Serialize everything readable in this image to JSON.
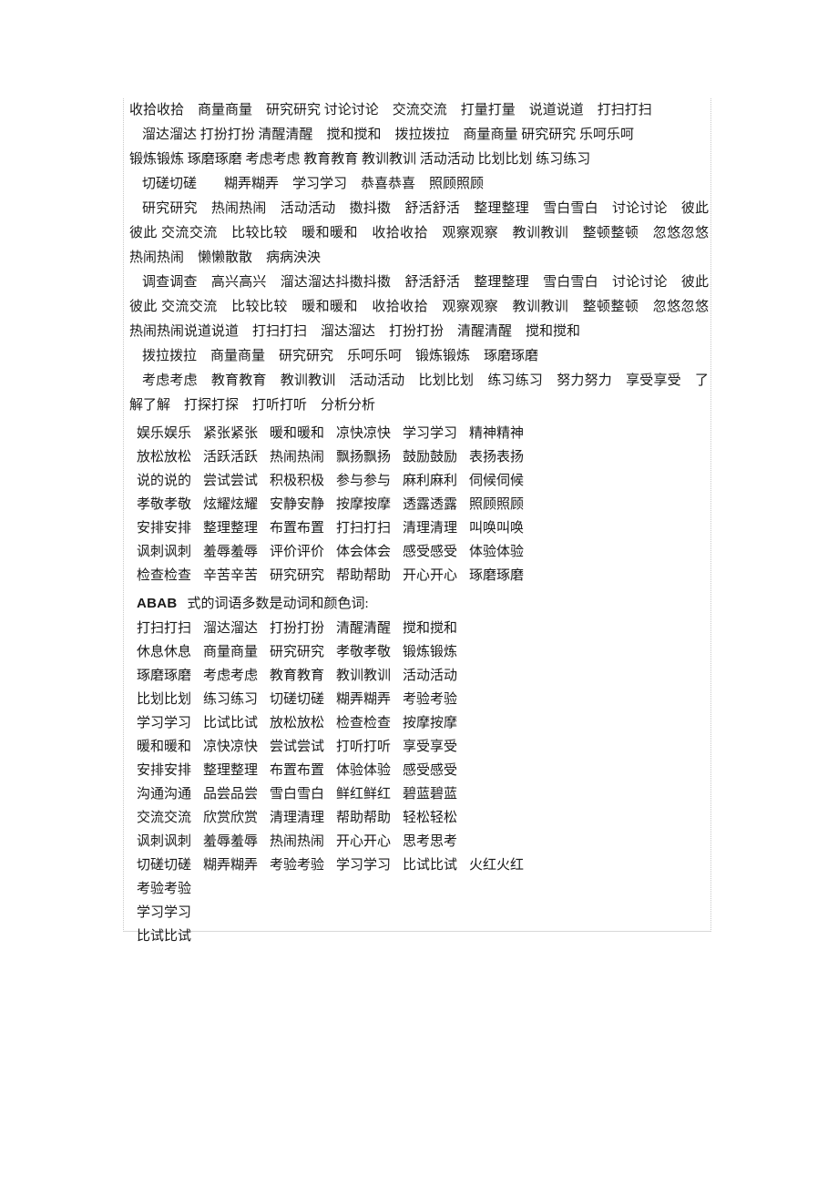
{
  "document": {
    "heading": {
      "abab_label": "ABAB",
      "rest": "式的词语多数是动词和颜色词:"
    },
    "blocks": [
      {
        "name": "block-aabb-verbs-1",
        "lines": [
          "收拾收拾　商量商量　研究研究 讨论讨论　交流交流　打量打量　说道说道　打扫打扫 溜达溜达 打扮打扮 清醒清醒 搅和搅和 拨拉拨拉 商量商量 研究研究 乐呵乐呵 锻炼锻炼 琢磨琢磨 考虑考虑 教育教育 教训教训 活动活动 比划比划 练习练习"
        ]
      }
    ],
    "paragraphs": [
      {
        "name": "para-1",
        "indent": false,
        "text": "收拾收拾　商量商量　研究研究 讨论讨论　交流交流　打量打量　说道说道　打扫打扫"
      },
      {
        "name": "para-2",
        "indent": true,
        "text": "溜达溜达 打扮打扮 清醒清醒　搅和搅和　拨拉拨拉　商量商量 研究研究 乐呵乐呵"
      },
      {
        "name": "para-3",
        "indent": false,
        "text": "锻炼锻炼 琢磨琢磨 考虑考虑 教育教育 教训教训 活动活动 比划比划 练习练习"
      },
      {
        "name": "para-4",
        "indent": true,
        "text": "切磋切磋　　糊弄糊弄　学习学习　恭喜恭喜　照顾照顾"
      },
      {
        "name": "para-5",
        "indent": true,
        "text": "研究研究　热闹热闹　活动活动　擞抖擞　舒活舒活　整理整理　雪白雪白　讨论讨论　彼此彼此 交流交流　比较比较　暖和暖和　收拾收拾　观察观察　教训教训　整顿整顿　忽悠忽悠　热闹热闹　懒懒散散　病病泱泱"
      },
      {
        "name": "para-6",
        "indent": true,
        "text": "调查调查　高兴高兴　溜达溜达抖擞抖擞　舒活舒活　整理整理　雪白雪白　讨论讨论　彼此彼此 交流交流　比较比较　暖和暖和　收拾收拾　观察观察　教训教训　整顿整顿　忽悠忽悠　热闹热闹说道说道　打扫打扫　溜达溜达　打扮打扮　清醒清醒　搅和搅和"
      },
      {
        "name": "para-7",
        "indent": true,
        "text": "拨拉拨拉　商量商量　研究研究　乐呵乐呵　锻炼锻炼　琢磨琢磨"
      },
      {
        "name": "para-8",
        "indent": true,
        "text": "考虑考虑　教育教育　教训教训　活动活动　比划比划　练习练习　努力努力　享受享受　了解了解　打探打探　打听打听　分析分析"
      }
    ],
    "grid_block_1": {
      "name": "verb-color-grid-six-column",
      "columns": 6,
      "rows": [
        [
          "娱乐娱乐",
          "紧张紧张",
          "暖和暖和",
          "凉快凉快",
          "学习学习",
          "精神精神"
        ],
        [
          "放松放松",
          "活跃活跃",
          "热闹热闹",
          "飘扬飘扬",
          "鼓励鼓励",
          "表扬表扬"
        ],
        [
          "说的说的",
          "尝试尝试",
          "积极积极",
          "参与参与",
          "麻利麻利",
          "伺候伺候"
        ],
        [
          "孝敬孝敬",
          "炫耀炫耀",
          "安静安静",
          "按摩按摩",
          "透露透露",
          "照顾照顾"
        ],
        [
          "安排安排",
          "整理整理",
          "布置布置",
          "打扫打扫",
          "清理清理",
          "叫唤叫唤"
        ],
        [
          "讽刺讽刺",
          "羞辱羞辱",
          "评价评价",
          "体会体会",
          "感受感受",
          "体验体验"
        ],
        [
          "检查检查",
          "辛苦辛苦",
          "研究研究",
          "帮助帮助",
          "开心开心",
          "琢磨琢磨"
        ]
      ]
    },
    "grid_block_2": {
      "name": "abab-word-grid-five-column",
      "columns": 5,
      "rows": [
        [
          "打扫打扫",
          "溜达溜达",
          "打扮打扮",
          "清醒清醒",
          "搅和搅和"
        ],
        [
          "休息休息",
          "商量商量",
          "研究研究",
          "孝敬孝敬",
          "锻炼锻炼"
        ],
        [
          "琢磨琢磨",
          "考虑考虑",
          "教育教育",
          "教训教训",
          "活动活动"
        ],
        [
          "比划比划",
          "练习练习",
          "切磋切磋",
          "糊弄糊弄",
          "考验考验"
        ],
        [
          "学习学习",
          "比试比试",
          "放松放松",
          "检查检查",
          "按摩按摩"
        ],
        [
          "暖和暖和",
          "凉快凉快",
          "尝试尝试",
          "打听打听",
          "享受享受"
        ],
        [
          "安排安排",
          "整理整理",
          "布置布置",
          "体验体验",
          "感受感受"
        ],
        [
          "沟通沟通",
          "品尝品尝",
          "雪白雪白",
          "鲜红鲜红",
          "碧蓝碧蓝"
        ],
        [
          "交流交流",
          "欣赏欣赏",
          "清理清理",
          "帮助帮助",
          "轻松轻松"
        ],
        [
          "讽刺讽刺",
          "羞辱羞辱",
          "热闹热闹",
          "开心开心",
          "思考思考"
        ],
        [
          "切磋切磋",
          "糊弄糊弄",
          "考验考验",
          "学习学习",
          "比试比试",
          "火红火红"
        ],
        [
          "考验考验"
        ],
        [
          "学习学习"
        ],
        [
          "比试比试"
        ]
      ]
    }
  }
}
